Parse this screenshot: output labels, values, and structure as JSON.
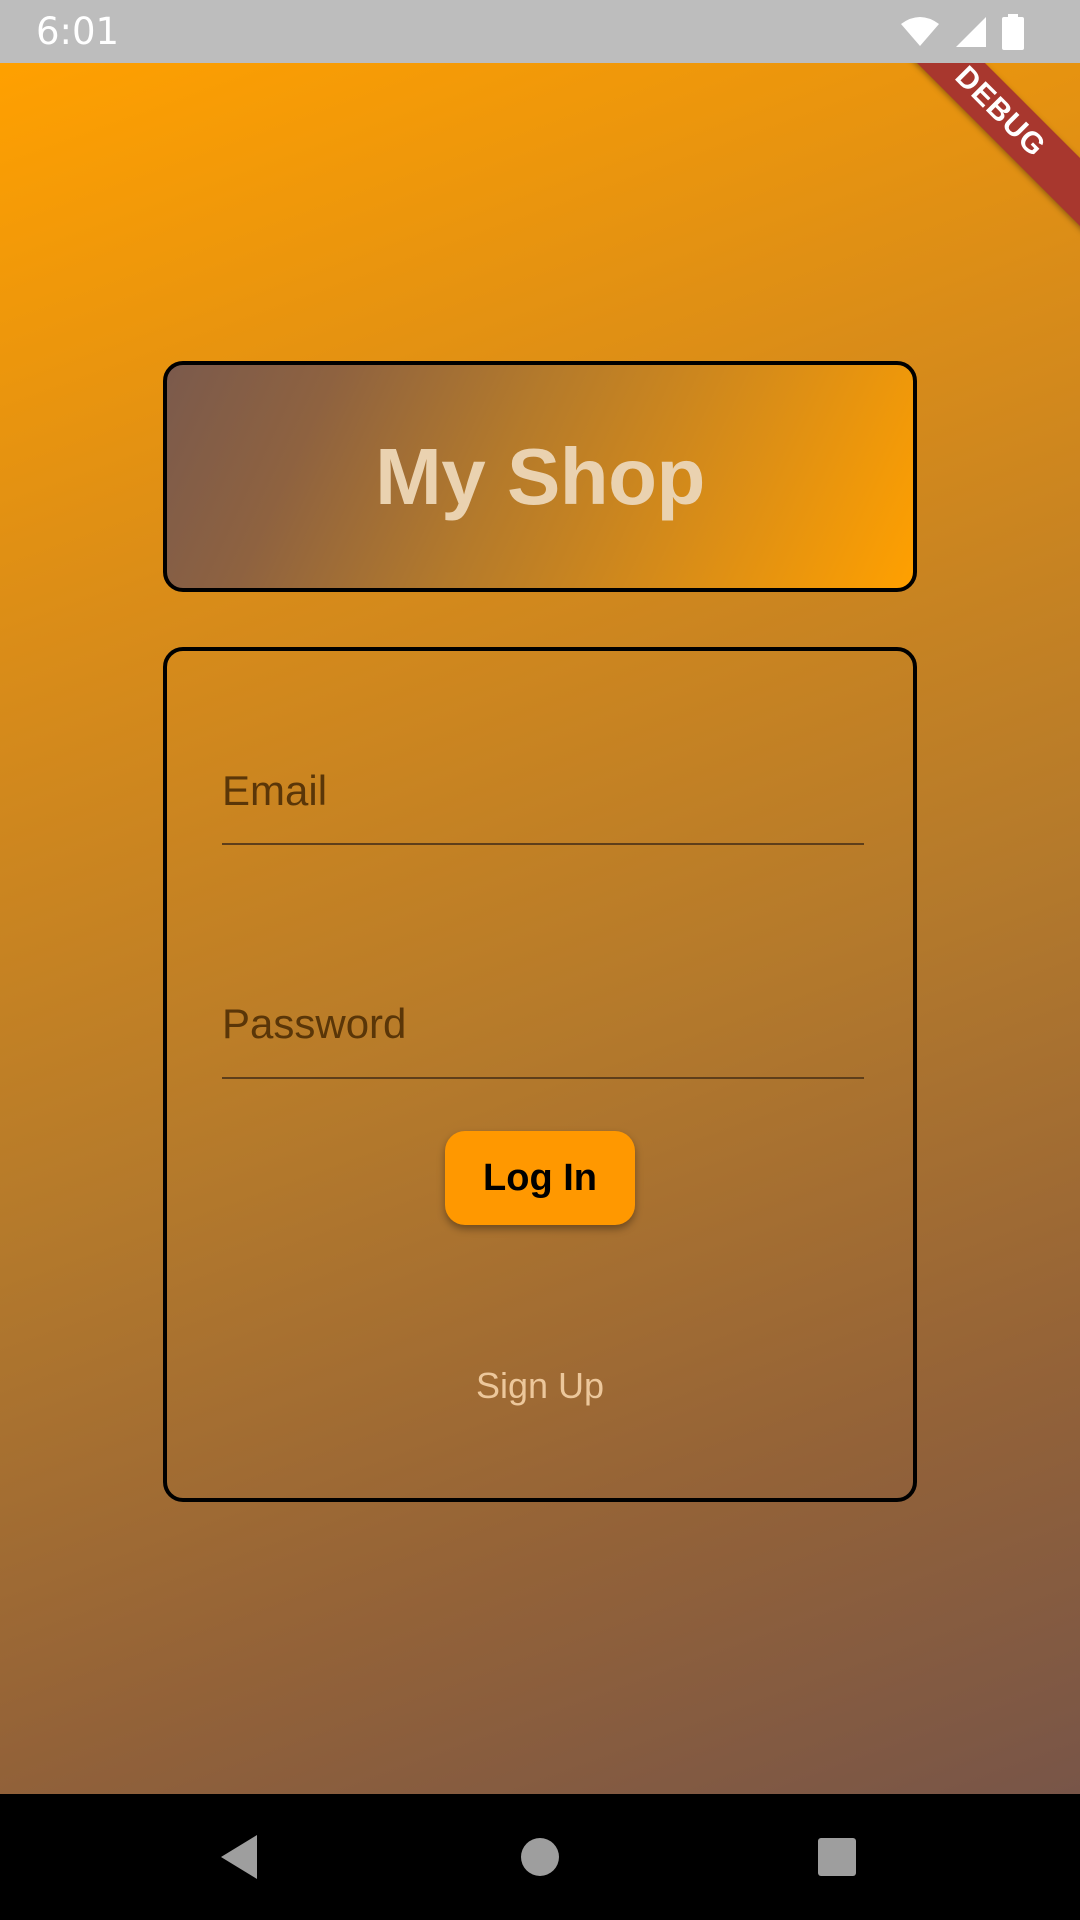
{
  "status_bar": {
    "time": "6:01",
    "icons": [
      "wifi-icon",
      "cell-signal-icon",
      "battery-icon"
    ]
  },
  "debug_banner": {
    "label": "DEBUG"
  },
  "title_card": {
    "title": "My Shop"
  },
  "form": {
    "email": {
      "placeholder": "Email",
      "value": ""
    },
    "password": {
      "placeholder": "Password",
      "value": ""
    },
    "login_label": "Log In",
    "signup_label": "Sign Up"
  },
  "nav_bar": {
    "buttons": [
      "back-icon",
      "home-icon",
      "recents-icon"
    ]
  },
  "colors": {
    "accent": "#ff9800",
    "gradient_start": "#ffa000",
    "gradient_end": "#785548",
    "title_text": "#ead2b0",
    "signup_text": "#ecc79b",
    "debug_banner": "#a8372e"
  }
}
